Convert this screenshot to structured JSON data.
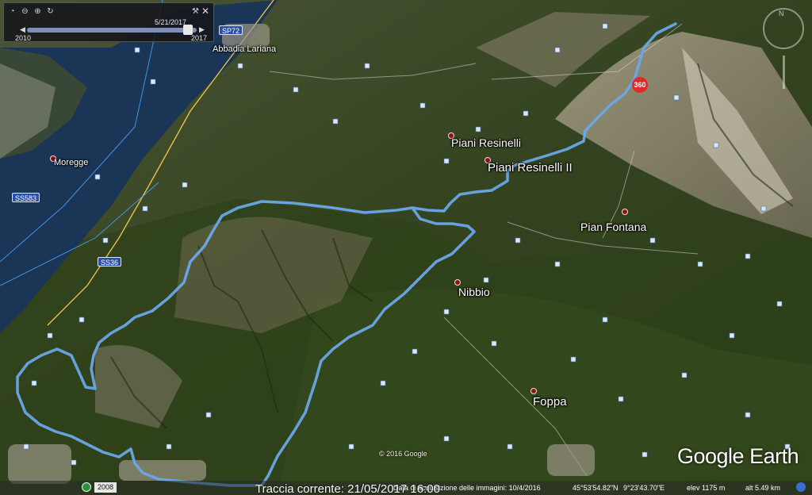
{
  "time_slider": {
    "current_date": "5/21/2017",
    "range_start": "2010",
    "range_end": "2017",
    "close_label": "✕"
  },
  "places": [
    {
      "name": "Abbadia Lariana"
    },
    {
      "name": "Moregge"
    },
    {
      "name": "Piani Resinelli"
    },
    {
      "name": "Piani Resinelli II"
    },
    {
      "name": "Pian Fontana"
    },
    {
      "name": "Nibbio"
    },
    {
      "name": "Foppa"
    }
  ],
  "road_shields": [
    "SP72",
    "SS583",
    "SS36",
    "SS36"
  ],
  "distance_marker": "360",
  "copyright": "© 2016 Google",
  "brand": "Google Earth",
  "status_bar": {
    "history_year": "2008",
    "track_label": "Traccia corrente: 21/05/2017 16:00",
    "imagery_date": "Data di acquisizione delle immagini: 10/4/2016",
    "latitude": "45°53'54.82\"N",
    "longitude": "9°23'43.70\"E",
    "elevation": "elev 1175 m",
    "altitude": "alt 5.49 km"
  },
  "colors": {
    "track": "#6aa8ea",
    "lake": "#1b3556",
    "pin": "#8b1414",
    "distance_marker": "#e02a2a"
  }
}
